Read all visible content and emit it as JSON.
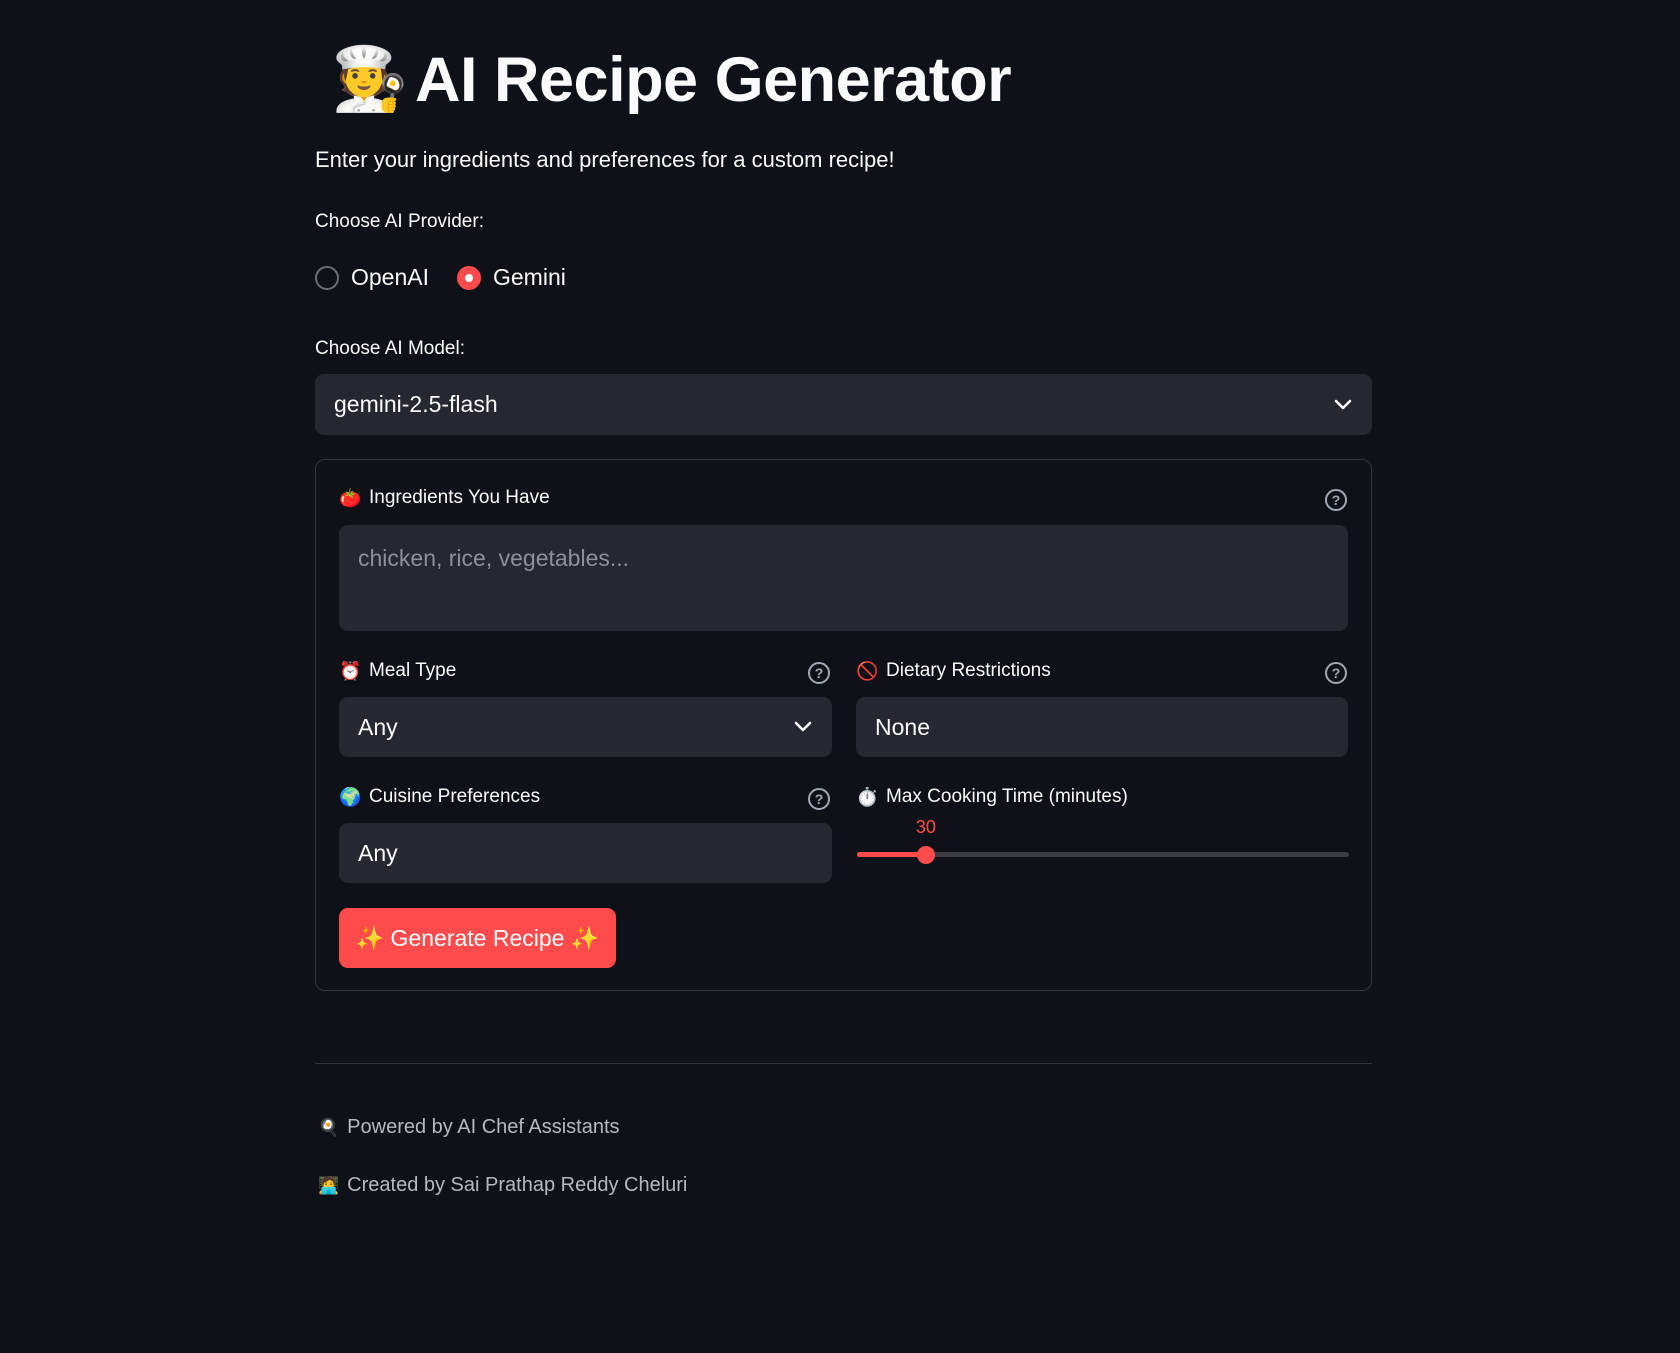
{
  "header": {
    "title_emoji": "🧑‍🍳",
    "title": "AI Recipe Generator",
    "subtitle": "Enter your ingredients and preferences for a custom recipe!"
  },
  "provider": {
    "label": "Choose AI Provider:",
    "options": [
      {
        "label": "OpenAI",
        "selected": false
      },
      {
        "label": "Gemini",
        "selected": true
      }
    ]
  },
  "model": {
    "label": "Choose AI Model:",
    "value": "gemini-2.5-flash"
  },
  "form": {
    "ingredients": {
      "emoji": "🍅",
      "label": "Ingredients You Have",
      "placeholder": "chicken, rice, vegetables..."
    },
    "meal_type": {
      "emoji": "⏰",
      "label": "Meal Type",
      "value": "Any"
    },
    "dietary": {
      "emoji": "🚫",
      "label": "Dietary Restrictions",
      "value": "None"
    },
    "cuisine": {
      "emoji": "🌍",
      "label": "Cuisine Preferences",
      "value": "Any"
    },
    "cooking_time": {
      "emoji": "⏱️",
      "label": "Max Cooking Time (minutes)",
      "value": "30",
      "fraction": 0.14
    },
    "generate_button": "✨ Generate Recipe ✨"
  },
  "footer": {
    "powered_emoji": "🍳",
    "powered": "Powered by AI Chef Assistants",
    "created_emoji": "🧑‍💻",
    "created": "Created by Sai Prathap Reddy Cheluri"
  },
  "colors": {
    "background": "#0e1117",
    "accent": "#ff4b4b",
    "input_bg": "#262730"
  }
}
